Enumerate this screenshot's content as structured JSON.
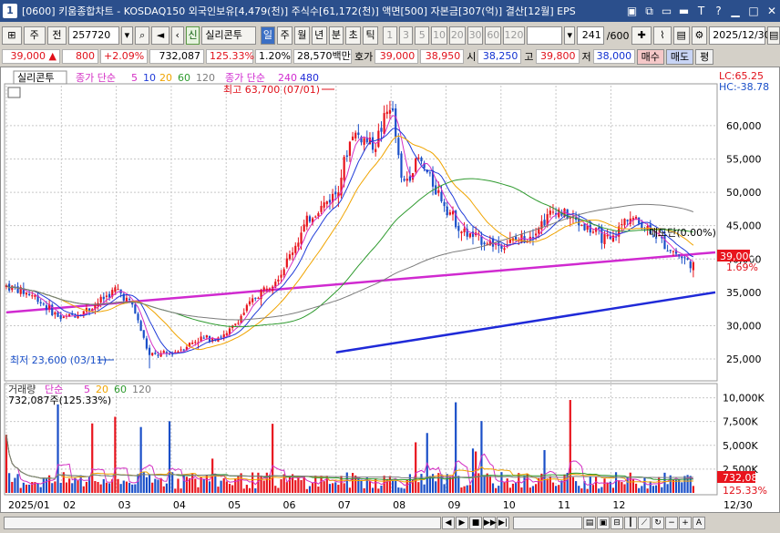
{
  "titlebar": {
    "app_number": "1",
    "title": "[0600] 키움종합차트 - KOSDAQ150 외국인보유[4,479(천)] 주식수[61,172(천)] 액면[500] 자본금[307(억)] 결산[12월] EPS",
    "icons": [
      "save-icon",
      "copy-icon",
      "restore-window-icon",
      "screen-icon",
      "text-icon",
      "help-icon"
    ],
    "window_controls": [
      "minimize",
      "maximize",
      "close"
    ]
  },
  "toolbar": {
    "market": "주",
    "jeon": "전",
    "code": "257720",
    "stock_name": "실리콘투",
    "sin": "신",
    "periods": [
      "일",
      "주",
      "월",
      "년",
      "분",
      "초",
      "틱"
    ],
    "active_period": "일",
    "intervals": [
      "1",
      "3",
      "5",
      "10",
      "20",
      "30",
      "60",
      "120"
    ],
    "count": "241",
    "count_total": "/600",
    "date": "2025/12/30"
  },
  "pricebar": {
    "price": "39,000",
    "change_arrow": "▲",
    "change": "800",
    "change_pct": "+2.09%",
    "volume": "732,087",
    "volume_ratio": "125.33%",
    "turnover_pct": "1.20%",
    "amount": "28,570백만",
    "hoga_label": "호가",
    "ask": "39,000",
    "bid": "38,950",
    "open_label": "시",
    "open": "38,250",
    "high_label": "고",
    "high": "39,800",
    "low_label": "저",
    "low": "38,000",
    "buy_btn": "매수",
    "sell_btn": "매도",
    "extra_btn": "평"
  },
  "chart": {
    "stock_tag": "실리콘투",
    "legend_price": {
      "label": "종가 단순",
      "periods": [
        "5",
        "10",
        "20",
        "60",
        "120"
      ],
      "label2": "종가 단순",
      "periods2": [
        "240",
        "480"
      ]
    },
    "legend_volume": {
      "label": "거래량",
      "label2": "단순",
      "periods": [
        "5",
        "20",
        "60",
        "120"
      ],
      "value": "732,087주(125.33%)"
    },
    "lc": "LC:65.25",
    "hc": "HC:-38.78",
    "annotation_high": "최고 63,700 (07/01)",
    "annotation_low": "최저 23,600 (03/11)",
    "annotation_right": "매도단(0.00%)",
    "current_price_label": "39,000",
    "current_pct_label": "1.69%",
    "volume_price_label": "732,087",
    "volume_pct_label": "125.33%",
    "x_end_label": "12/30",
    "colors": {
      "up": "#e8141d",
      "down": "#1a4fc8",
      "ma5": "#d42fc4",
      "ma10": "#1f3bd8",
      "ma20": "#f0a400",
      "ma60": "#2e9a2e",
      "ma120": "#7d7d7d",
      "ma240": "#d02ad0",
      "ma480": "#1f2ad8"
    }
  },
  "chart_data": {
    "type": "candlestick",
    "x_labels": [
      "2025/01",
      "02",
      "03",
      "04",
      "05",
      "06",
      "07",
      "08",
      "09",
      "10",
      "11",
      "12"
    ],
    "y_ticks": [
      25000,
      30000,
      35000,
      40000,
      45000,
      50000,
      55000,
      60000
    ],
    "y_tick_labels": [
      "25,000",
      "30,000",
      "35,000",
      "40,000",
      "45,000",
      "50,000",
      "55,000",
      "60,000"
    ],
    "ylim": [
      22000,
      66000
    ],
    "volume_ticks": [
      2500,
      5000,
      7500,
      10000
    ],
    "volume_tick_labels": [
      "2,500K",
      "5,000K",
      "7,500K",
      "10,000K"
    ],
    "volume_ylim": [
      0,
      11300
    ],
    "close_trajectory": [
      [
        0,
        36000
      ],
      [
        0.5,
        34500
      ],
      [
        1,
        31000
      ],
      [
        1.5,
        32500
      ],
      [
        2,
        35500
      ],
      [
        2.3,
        33000
      ],
      [
        2.6,
        25500
      ],
      [
        3,
        25800
      ],
      [
        3.5,
        28000
      ],
      [
        4,
        28500
      ],
      [
        4.5,
        34000
      ],
      [
        5,
        38000
      ],
      [
        5.5,
        46000
      ],
      [
        6,
        50000
      ],
      [
        6.3,
        59000
      ],
      [
        6.7,
        57000
      ],
      [
        7,
        63500
      ],
      [
        7.2,
        51000
      ],
      [
        7.5,
        55000
      ],
      [
        8,
        48000
      ],
      [
        8.3,
        44000
      ],
      [
        8.6,
        43000
      ],
      [
        9,
        42000
      ],
      [
        9.5,
        43500
      ],
      [
        10,
        47500
      ],
      [
        10.5,
        45000
      ],
      [
        11,
        42500
      ],
      [
        11.3,
        46500
      ],
      [
        11.7,
        44500
      ],
      [
        12,
        42000
      ],
      [
        12.5,
        39000
      ]
    ],
    "ma_long_240": [
      [
        0,
        32000
      ],
      [
        12.9,
        41000
      ]
    ],
    "ma_long_480": [
      [
        6,
        26000
      ],
      [
        12.9,
        35000
      ]
    ],
    "volume_current": 732087
  }
}
